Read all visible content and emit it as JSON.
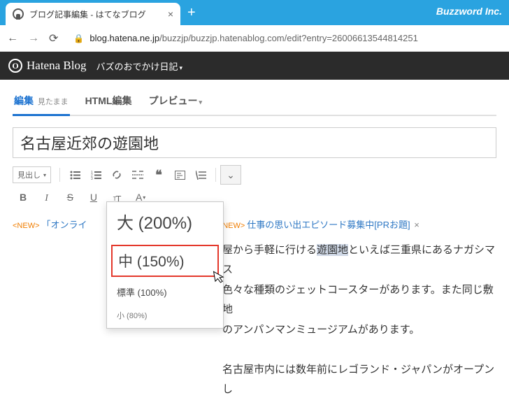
{
  "browser": {
    "brand": "Buzzword Inc.",
    "tab_title": "ブログ記事編集 - はてなブログ",
    "tab_close": "×",
    "newtab": "+",
    "url_display_host": "blog.hatena.ne.jp",
    "url_display_path": "/buzzjp/buzzjp.hatenablog.com/edit?entry=26006613544814251"
  },
  "hatena": {
    "mark": "O",
    "logo": "Hatena Blog",
    "blog_name": "バズのおでかけ日記",
    "caret": "▾"
  },
  "editor_tabs": {
    "edit": "編集",
    "edit_sub": "見たまま",
    "html": "HTML編集",
    "preview": "プレビュー",
    "caret": "▾"
  },
  "post": {
    "title": "名古屋近郊の遊園地"
  },
  "toolbar": {
    "heading_sel": "見出し",
    "sel_caret": "▾",
    "chevron": "⌄"
  },
  "topics": {
    "new1": "<NEW>",
    "t1": "「オンライ",
    "new2": "<NEW>",
    "t2": "仕事の思い出エピソード募集中[PRお題]",
    "close": "×"
  },
  "body": {
    "l1a": "屋から手軽に行ける",
    "l1hl": "遊園地",
    "l1b": "といえば三重県にあるナガシマス",
    "l2": "色々な種類のジェットコースターがあります。また同じ敷地",
    "l3": "のアンパンマンミュージアムがあります。",
    "l4": "名古屋市内には数年前にレゴランド・ジャパンがオープンし"
  },
  "fontsize_menu": {
    "big": "大 (200%)",
    "med": "中 (150%)",
    "std": "標準 (100%)",
    "sm": "小 (80%)"
  }
}
